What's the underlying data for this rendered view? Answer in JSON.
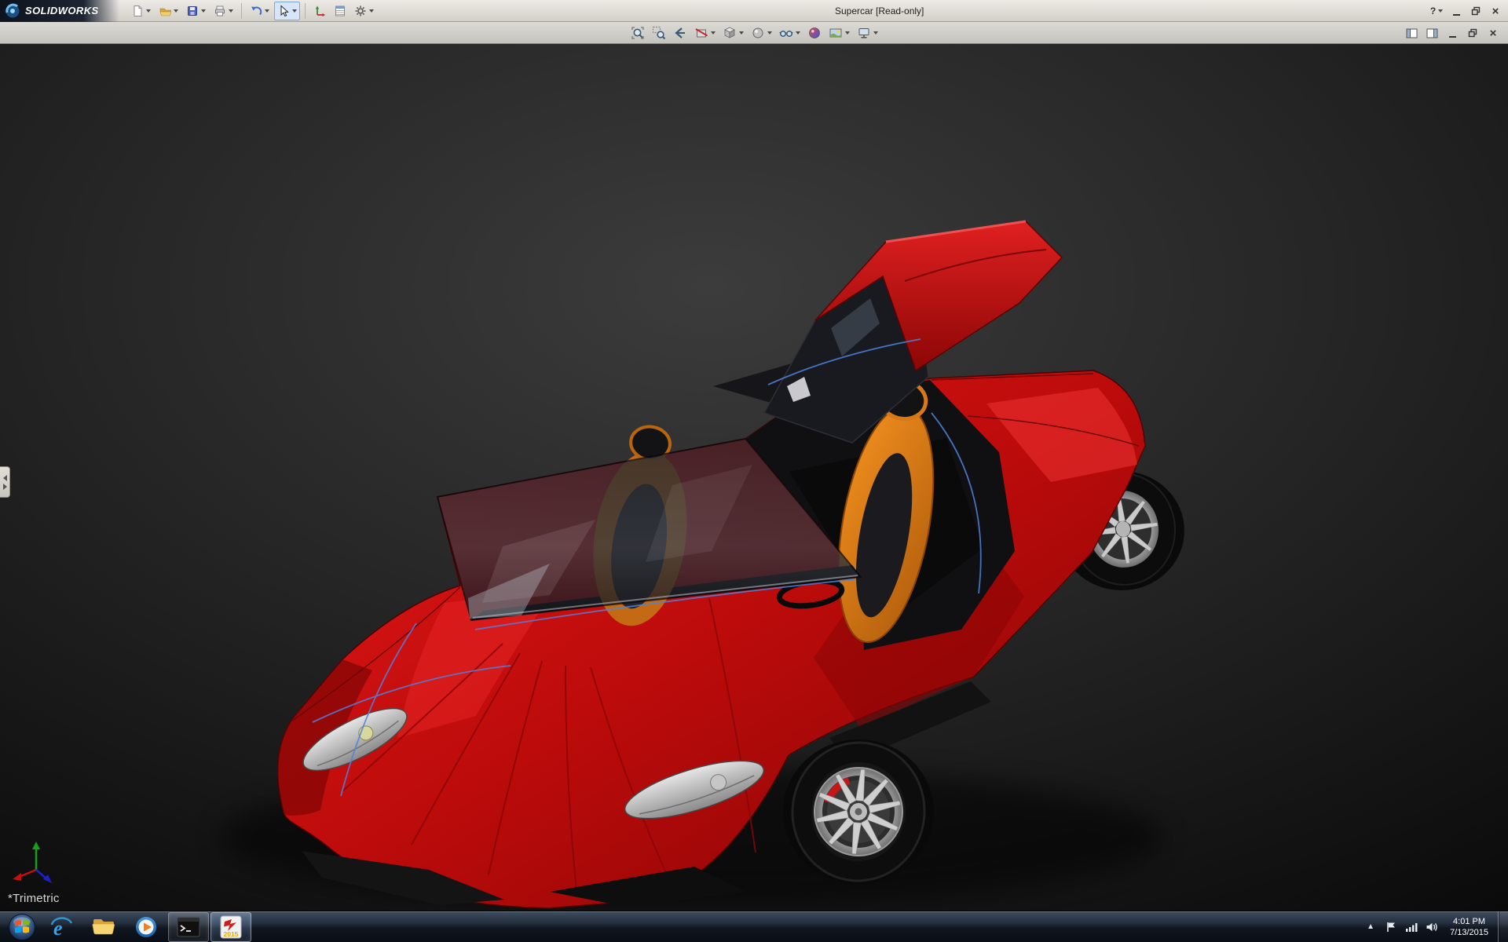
{
  "window": {
    "brand": "SOLIDWORKS",
    "title": "Supercar [Read-only]",
    "help_glyph": "?"
  },
  "main_toolbar": {
    "icons": [
      "new-document",
      "open",
      "save",
      "print",
      "undo",
      "select",
      "instant3d",
      "file-properties",
      "options"
    ]
  },
  "view_toolbar": {
    "icons": [
      "zoom-to-fit",
      "zoom-to-area",
      "previous-view",
      "section-view",
      "view-orientation",
      "display-style",
      "hide-show-items",
      "edit-appearance",
      "apply-scene",
      "view-settings"
    ]
  },
  "document_controls": {
    "icons": [
      "pane-left",
      "pane-right",
      "minimize-document",
      "restore-document",
      "close-document"
    ]
  },
  "viewport": {
    "orientation_label": "*Trimetric"
  },
  "colors": {
    "body_red": "#bc0b0b",
    "seat_orange": "#e07818",
    "background_dark": "#1e1e1e",
    "taskbar_glass": "#222c3a"
  },
  "taskbar": {
    "items": [
      "start",
      "internet-explorer",
      "windows-explorer",
      "windows-media-player",
      "command-prompt",
      "solidworks-2015"
    ],
    "ie_glyph": "e",
    "solidworks_badge": "2015",
    "time": "4:01 PM",
    "date": "7/13/2015"
  }
}
